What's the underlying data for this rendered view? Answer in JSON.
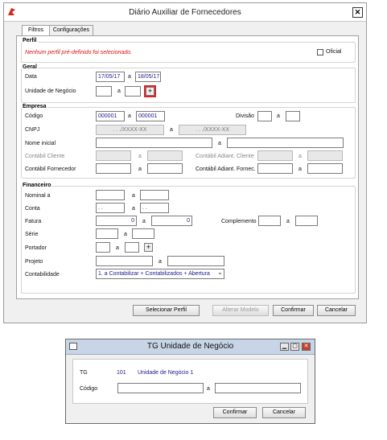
{
  "main_window": {
    "title": "Diário Auxiliar de Fornecedores",
    "close_glyph": "✕",
    "tabs": [
      {
        "label": "Filtros",
        "active": true
      },
      {
        "label": "Configurações",
        "active": false
      }
    ],
    "perfil": {
      "title": "Perfil",
      "message": "Nenhum perfil pré-definido foi selecionado.",
      "oficial_label": "Oficial"
    },
    "geral": {
      "title": "Geral",
      "data_label": "Data",
      "data_from": "17/05/17",
      "data_a": "a",
      "data_to": "18/05/17",
      "unidade_label": "Unidade de Negócio",
      "unidade_a": "a",
      "plus_glyph": "+"
    },
    "empresa": {
      "title": "Empresa",
      "codigo_label": "Código",
      "codigo_from": "000001",
      "codigo_a": "a",
      "codigo_to": "000001",
      "divisao_label": "Divisão",
      "divisao_a": "a",
      "cnpj_label": "CNPJ",
      "cnpj_mask": ". . ./XXXX-XX",
      "cnpj_a": "a",
      "nome_label": "Nome inicial",
      "nome_a": "a",
      "contabil_cliente_label": "Contábil Cliente",
      "contabil_cliente_a": "a",
      "contabil_adiant_cliente_label": "Contábil Adiant. Cliente",
      "contabil_adiant_cliente_a": "a",
      "contabil_fornecedor_label": "Contábil Fornecedor",
      "contabil_fornecedor_a": "a",
      "contabil_adiant_fornec_label": "Contábil Adiant. Fornec.",
      "contabil_adiant_fornec_a": "a"
    },
    "financeiro": {
      "title": "Financeiro",
      "nominal_label": "Nominal a",
      "nominal_a": "a",
      "conta_label": "Conta",
      "conta_mask": ". .",
      "conta_a": "a",
      "fatura_label": "Fatura",
      "fatura_from": "0",
      "fatura_a": "a",
      "fatura_to": "0",
      "complemento_label": "Complemento",
      "complemento_a": "a",
      "serie_label": "Série",
      "serie_a": "a",
      "portador_label": "Portador",
      "portador_a": "a",
      "projeto_label": "Projeto",
      "projeto_a": "a",
      "contabilidade_label": "Contabilidade",
      "contabilidade_value": "1. a Contabilizar + Contabilizados + Abertura",
      "dropdown_glyph": "⌄"
    },
    "buttons": {
      "selecionar_perfil": "Selecionar Perfil",
      "alterar_modelo": "Alterar Modelo",
      "confirmar": "Confirmar",
      "cancelar": "Cancelar"
    }
  },
  "dialog": {
    "title": "TG Unidade de Negócio",
    "window_glyphs": {
      "minimize": "▁",
      "maximize": "▢",
      "close": "✕"
    },
    "tg_label": "TG",
    "tg_code": "101",
    "tg_name": "Unidade de Negócio 1",
    "codigo_label": "Código",
    "codigo_a": "a",
    "buttons": {
      "confirmar": "Confirmar",
      "cancelar": "Cancelar"
    }
  },
  "colors": {
    "error_text": "#dd1111",
    "value_text": "#1a1a8c",
    "dialog_title_bg": "#c7d5e6"
  }
}
